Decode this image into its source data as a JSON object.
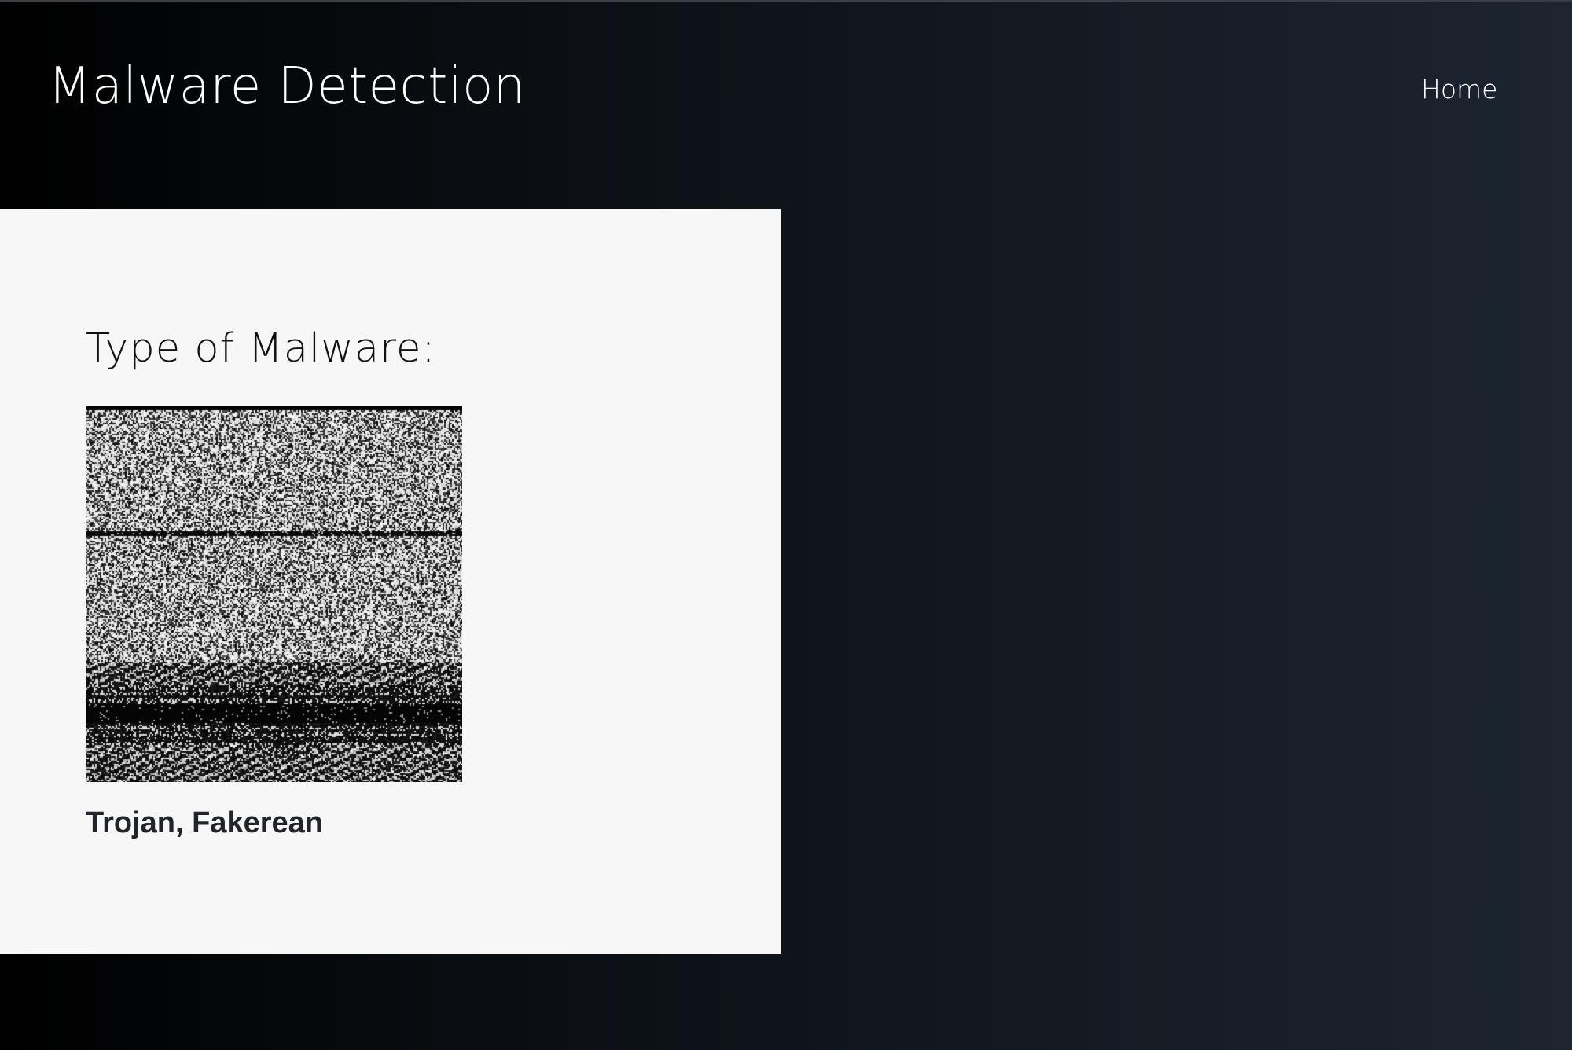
{
  "header": {
    "brand": "Malware Detection",
    "nav": {
      "home_label": "Home"
    }
  },
  "result_card": {
    "title": "Type of Malware:",
    "image_icon": "malware-grayscale-image",
    "prediction": "Trojan, Fakerean"
  },
  "colors": {
    "background_start": "#000000",
    "background_end": "#1c2530",
    "card": "#f7f7f7",
    "text_light": "#ffffff",
    "text_dark": "#212529"
  }
}
